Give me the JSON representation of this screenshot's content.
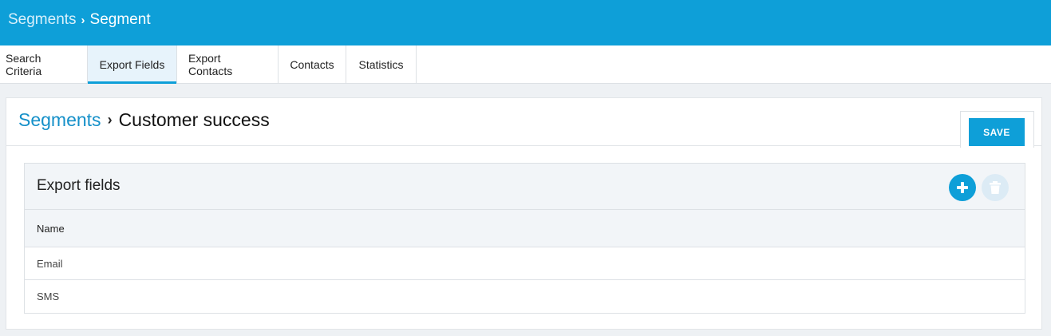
{
  "topbar": {
    "root": "Segments",
    "current": "Segment"
  },
  "tabs": [
    {
      "label": "Search Criteria"
    },
    {
      "label": "Export Fields"
    },
    {
      "label": "Export Contacts"
    },
    {
      "label": "Contacts"
    },
    {
      "label": "Statistics"
    }
  ],
  "active_tab": "Export Fields",
  "page": {
    "root": "Segments",
    "name": "Customer success",
    "save_label": "SAVE"
  },
  "panel": {
    "title": "Export fields",
    "column_header": "Name",
    "rows": [
      {
        "name": "Email"
      },
      {
        "name": "SMS"
      }
    ]
  },
  "icons": {
    "add": "plus-icon",
    "delete": "trash-icon"
  },
  "colors": {
    "accent": "#0e9fd8",
    "link": "#1590c9",
    "disabled": "#dcebf5"
  }
}
